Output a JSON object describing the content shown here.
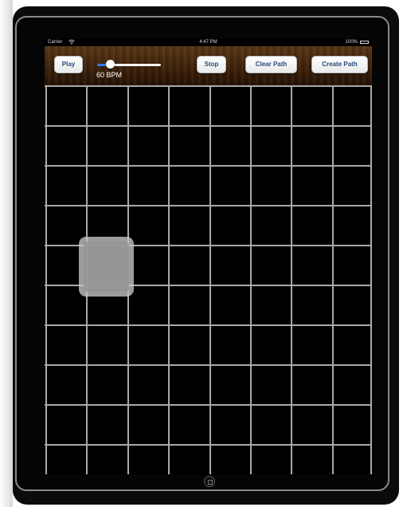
{
  "status_bar": {
    "carrier": "Carrier",
    "wifi_icon": "wifi-icon",
    "time": "4:47 PM",
    "battery": "100%",
    "battery_icon": "battery-icon"
  },
  "toolbar": {
    "play_label": "Play",
    "stop_label": "Stop",
    "clear_path_label": "Clear Path",
    "create_path_label": "Create Path",
    "tempo_slider_fraction": 0.2,
    "tempo_label": "60 BPM"
  },
  "grid": {
    "columns": 8,
    "rows_visible": 10,
    "selected_cell": {
      "column": 1,
      "row": 4
    }
  },
  "colors": {
    "button_text": "#294a7a",
    "slider_fill": "#2f7cf0",
    "grid_line": "#a9a9a9",
    "toolbar_wood": "#4a2a10"
  }
}
